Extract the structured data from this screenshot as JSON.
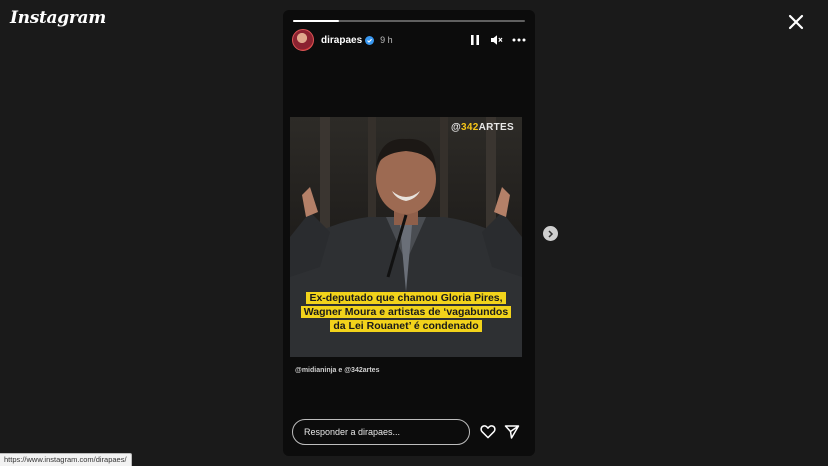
{
  "app": {
    "logo_text": "Instagram"
  },
  "story": {
    "username": "dirapaes",
    "time": "9 h",
    "progress": 0.2,
    "image": {
      "watermark_prefix": "@",
      "watermark_highlight": "342",
      "watermark_suffix": "ARTES",
      "headline_lines": [
        "Ex-deputado que chamou Gloria Pires,",
        "Wagner Moura e artistas de ‘vagabundos",
        "da Lei Rouanet’ é condenado"
      ]
    },
    "credits": "@midianinja e @342artes"
  },
  "reply": {
    "placeholder": "Responder a dirapaes..."
  },
  "statusbar": {
    "url": "https://www.instagram.com/dirapaes/"
  },
  "colors": {
    "headline_bg": "#f2d31b",
    "watermark_accent": "#f5c518",
    "background": "#1a1a1a"
  },
  "icons": {
    "close": "close-icon",
    "verified": "verified-badge-icon",
    "pause": "pause-icon",
    "mute": "muted-speaker-icon",
    "more": "more-options-icon",
    "like": "heart-icon",
    "share": "send-icon",
    "next": "chevron-right-icon"
  }
}
